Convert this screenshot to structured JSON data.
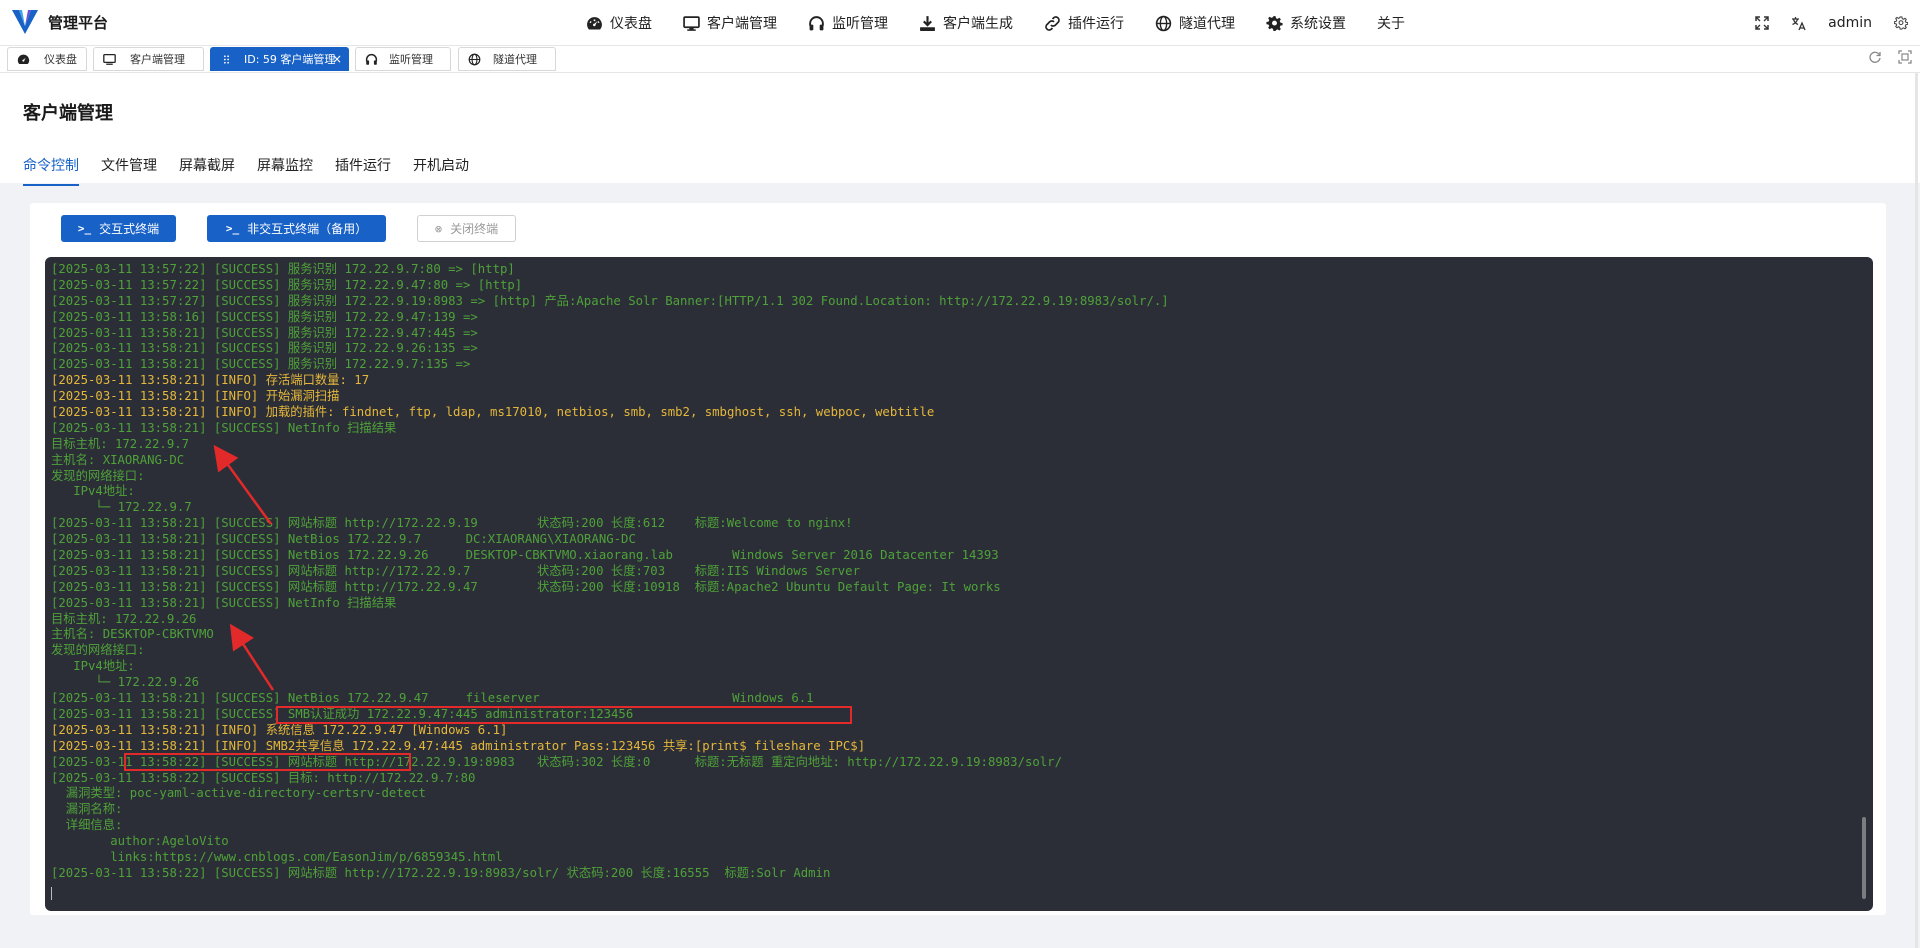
{
  "app": {
    "title": "管理平台",
    "colors": {
      "primary": "#1861c6",
      "success_text": "#4fa13a",
      "info_text": "#e5b73b",
      "terminal_bg": "#2b2e36",
      "annotation": "#e32a2a"
    }
  },
  "topnav": [
    {
      "label": "仪表盘",
      "icon": "dashboard-icon"
    },
    {
      "label": "客户端管理",
      "icon": "monitor-icon"
    },
    {
      "label": "监听管理",
      "icon": "headphones-icon"
    },
    {
      "label": "客户端生成",
      "icon": "download-icon"
    },
    {
      "label": "插件运行",
      "icon": "link-icon"
    },
    {
      "label": "隧道代理",
      "icon": "globe-icon"
    },
    {
      "label": "系统设置",
      "icon": "gear-icon"
    },
    {
      "label": "关于",
      "icon": ""
    }
  ],
  "topright": {
    "user": "admin"
  },
  "tabs": [
    {
      "label": "仪表盘",
      "icon": "dashboard-icon",
      "active": false
    },
    {
      "label": "客户端管理",
      "icon": "monitor-icon",
      "active": false
    },
    {
      "label": "ID: 59 客户端管理",
      "icon": "drag-icon",
      "active": true,
      "close": "×"
    },
    {
      "label": "监听管理",
      "icon": "headphones-icon",
      "active": false
    },
    {
      "label": "隧道代理",
      "icon": "globe-icon",
      "active": false
    }
  ],
  "page": {
    "title": "客户端管理",
    "subtabs": [
      "命令控制",
      "文件管理",
      "屏幕截屏",
      "屏幕监控",
      "插件运行",
      "开机启动"
    ],
    "active_subtab": "命令控制"
  },
  "buttons": {
    "interactive": {
      "icon": ">_",
      "label": "交互式终端"
    },
    "noninteractive": {
      "icon": ">_",
      "label": "非交互式终端（备用）"
    },
    "close": {
      "icon": "⊗",
      "label": "关闭终端"
    }
  },
  "terminal": {
    "lines": [
      {
        "text": "[2025-03-11 13:57:22] [SUCCESS] 服务识别 172.22.9.7:80 => [http]",
        "type": "success"
      },
      {
        "text": "[2025-03-11 13:57:22] [SUCCESS] 服务识别 172.22.9.47:80 => [http]",
        "type": "success"
      },
      {
        "text": "[2025-03-11 13:57:27] [SUCCESS] 服务识别 172.22.9.19:8983 => [http] 产品:Apache Solr Banner:[HTTP/1.1 302 Found.Location: http://172.22.9.19:8983/solr/.]",
        "type": "success"
      },
      {
        "text": "[2025-03-11 13:58:16] [SUCCESS] 服务识别 172.22.9.47:139 =>",
        "type": "success"
      },
      {
        "text": "[2025-03-11 13:58:21] [SUCCESS] 服务识别 172.22.9.47:445 =>",
        "type": "success"
      },
      {
        "text": "[2025-03-11 13:58:21] [SUCCESS] 服务识别 172.22.9.26:135 =>",
        "type": "success"
      },
      {
        "text": "[2025-03-11 13:58:21] [SUCCESS] 服务识别 172.22.9.7:135 =>",
        "type": "success"
      },
      {
        "text": "[2025-03-11 13:58:21] [INFO] 存活端口数量: 17",
        "type": "info"
      },
      {
        "text": "[2025-03-11 13:58:21] [INFO] 开始漏洞扫描",
        "type": "info"
      },
      {
        "text": "[2025-03-11 13:58:21] [INFO] 加载的插件: findnet, ftp, ldap, ms17010, netbios, smb, smb2, smbghost, ssh, webpoc, webtitle",
        "type": "info"
      },
      {
        "text": "[2025-03-11 13:58:21] [SUCCESS] NetInfo 扫描结果",
        "type": "success"
      },
      {
        "text": "目标主机: 172.22.9.7",
        "type": "success"
      },
      {
        "text": "主机名: XIAORANG-DC",
        "type": "success"
      },
      {
        "text": "发现的网络接口:",
        "type": "success"
      },
      {
        "text": "   IPv4地址:",
        "type": "success"
      },
      {
        "text": "      └─ 172.22.9.7",
        "type": "success"
      },
      {
        "text": "[2025-03-11 13:58:21] [SUCCESS] 网站标题 http://172.22.9.19        状态码:200 长度:612    标题:Welcome to nginx!",
        "type": "success"
      },
      {
        "text": "[2025-03-11 13:58:21] [SUCCESS] NetBios 172.22.9.7      DC:XIAORANG\\XIAORANG-DC",
        "type": "success"
      },
      {
        "text": "[2025-03-11 13:58:21] [SUCCESS] NetBios 172.22.9.26     DESKTOP-CBKTVMO.xiaorang.lab        Windows Server 2016 Datacenter 14393",
        "type": "success"
      },
      {
        "text": "[2025-03-11 13:58:21] [SUCCESS] 网站标题 http://172.22.9.7         状态码:200 长度:703    标题:IIS Windows Server",
        "type": "success"
      },
      {
        "text": "[2025-03-11 13:58:21] [SUCCESS] 网站标题 http://172.22.9.47        状态码:200 长度:10918  标题:Apache2 Ubuntu Default Page: It works",
        "type": "success"
      },
      {
        "text": "[2025-03-11 13:58:21] [SUCCESS] NetInfo 扫描结果",
        "type": "success"
      },
      {
        "text": "目标主机: 172.22.9.26",
        "type": "success"
      },
      {
        "text": "主机名: DESKTOP-CBKTVMO",
        "type": "success"
      },
      {
        "text": "发现的网络接口:",
        "type": "success"
      },
      {
        "text": "   IPv4地址:",
        "type": "success"
      },
      {
        "text": "      └─ 172.22.9.26",
        "type": "success"
      },
      {
        "text": "[2025-03-11 13:58:21] [SUCCESS] NetBios 172.22.9.47     fileserver                          Windows 6.1",
        "type": "success"
      },
      {
        "text": "[2025-03-11 13:58:21] [SUCCESS] SMB认证成功 172.22.9.47:445 administrator:123456",
        "type": "success"
      },
      {
        "text": "[2025-03-11 13:58:21] [INFO] 系统信息 172.22.9.47 [Windows 6.1]",
        "type": "info"
      },
      {
        "text": "[2025-03-11 13:58:21] [INFO] SMB2共享信息 172.22.9.47:445 administrator Pass:123456 共享:[print$ fileshare IPC$]",
        "type": "info"
      },
      {
        "text": "[2025-03-11 13:58:22] [SUCCESS] 网站标题 http://172.22.9.19:8983   状态码:302 长度:0      标题:无标题 重定向地址: http://172.22.9.19:8983/solr/",
        "type": "success"
      },
      {
        "text": "[2025-03-11 13:58:22] [SUCCESS] 目标: http://172.22.9.7:80",
        "type": "success"
      },
      {
        "text": "  漏洞类型: poc-yaml-active-directory-certsrv-detect",
        "type": "success"
      },
      {
        "text": "  漏洞名称:",
        "type": "success"
      },
      {
        "text": "  详细信息:",
        "type": "success"
      },
      {
        "text": "        author:AgeloVito",
        "type": "success"
      },
      {
        "text": "        links:https://www.cnblogs.com/EasonJim/p/6859345.html",
        "type": "success"
      },
      {
        "text": "[2025-03-11 13:58:22] [SUCCESS] 网站标题 http://172.22.9.19:8983/solr/ 状态码:200 长度:16555  标题:Solr Admin",
        "type": "success"
      }
    ]
  }
}
